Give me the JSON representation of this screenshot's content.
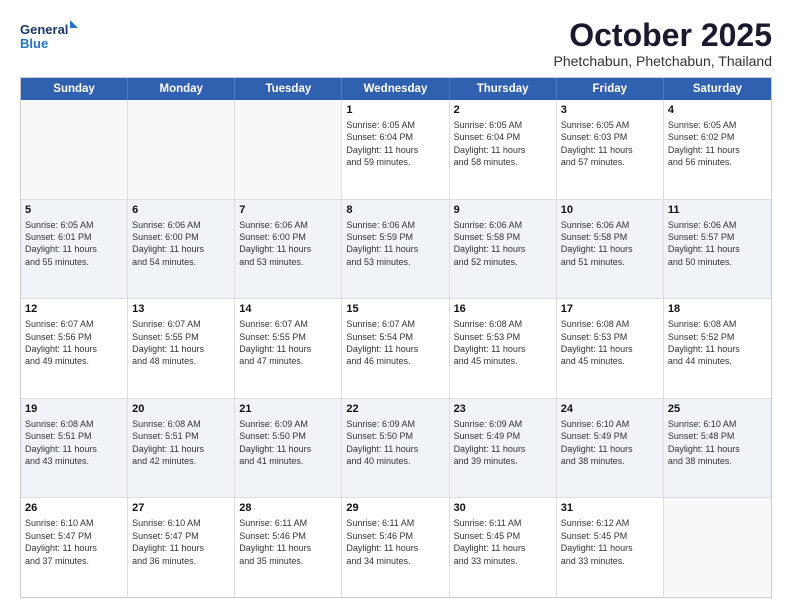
{
  "header": {
    "logo_line1": "General",
    "logo_line2": "Blue",
    "month": "October 2025",
    "location": "Phetchabun, Phetchabun, Thailand"
  },
  "weekdays": [
    "Sunday",
    "Monday",
    "Tuesday",
    "Wednesday",
    "Thursday",
    "Friday",
    "Saturday"
  ],
  "weeks": [
    [
      {
        "day": "",
        "info": ""
      },
      {
        "day": "",
        "info": ""
      },
      {
        "day": "",
        "info": ""
      },
      {
        "day": "1",
        "info": "Sunrise: 6:05 AM\nSunset: 6:04 PM\nDaylight: 11 hours\nand 59 minutes."
      },
      {
        "day": "2",
        "info": "Sunrise: 6:05 AM\nSunset: 6:04 PM\nDaylight: 11 hours\nand 58 minutes."
      },
      {
        "day": "3",
        "info": "Sunrise: 6:05 AM\nSunset: 6:03 PM\nDaylight: 11 hours\nand 57 minutes."
      },
      {
        "day": "4",
        "info": "Sunrise: 6:05 AM\nSunset: 6:02 PM\nDaylight: 11 hours\nand 56 minutes."
      }
    ],
    [
      {
        "day": "5",
        "info": "Sunrise: 6:05 AM\nSunset: 6:01 PM\nDaylight: 11 hours\nand 55 minutes."
      },
      {
        "day": "6",
        "info": "Sunrise: 6:06 AM\nSunset: 6:00 PM\nDaylight: 11 hours\nand 54 minutes."
      },
      {
        "day": "7",
        "info": "Sunrise: 6:06 AM\nSunset: 6:00 PM\nDaylight: 11 hours\nand 53 minutes."
      },
      {
        "day": "8",
        "info": "Sunrise: 6:06 AM\nSunset: 5:59 PM\nDaylight: 11 hours\nand 53 minutes."
      },
      {
        "day": "9",
        "info": "Sunrise: 6:06 AM\nSunset: 5:58 PM\nDaylight: 11 hours\nand 52 minutes."
      },
      {
        "day": "10",
        "info": "Sunrise: 6:06 AM\nSunset: 5:58 PM\nDaylight: 11 hours\nand 51 minutes."
      },
      {
        "day": "11",
        "info": "Sunrise: 6:06 AM\nSunset: 5:57 PM\nDaylight: 11 hours\nand 50 minutes."
      }
    ],
    [
      {
        "day": "12",
        "info": "Sunrise: 6:07 AM\nSunset: 5:56 PM\nDaylight: 11 hours\nand 49 minutes."
      },
      {
        "day": "13",
        "info": "Sunrise: 6:07 AM\nSunset: 5:55 PM\nDaylight: 11 hours\nand 48 minutes."
      },
      {
        "day": "14",
        "info": "Sunrise: 6:07 AM\nSunset: 5:55 PM\nDaylight: 11 hours\nand 47 minutes."
      },
      {
        "day": "15",
        "info": "Sunrise: 6:07 AM\nSunset: 5:54 PM\nDaylight: 11 hours\nand 46 minutes."
      },
      {
        "day": "16",
        "info": "Sunrise: 6:08 AM\nSunset: 5:53 PM\nDaylight: 11 hours\nand 45 minutes."
      },
      {
        "day": "17",
        "info": "Sunrise: 6:08 AM\nSunset: 5:53 PM\nDaylight: 11 hours\nand 45 minutes."
      },
      {
        "day": "18",
        "info": "Sunrise: 6:08 AM\nSunset: 5:52 PM\nDaylight: 11 hours\nand 44 minutes."
      }
    ],
    [
      {
        "day": "19",
        "info": "Sunrise: 6:08 AM\nSunset: 5:51 PM\nDaylight: 11 hours\nand 43 minutes."
      },
      {
        "day": "20",
        "info": "Sunrise: 6:08 AM\nSunset: 5:51 PM\nDaylight: 11 hours\nand 42 minutes."
      },
      {
        "day": "21",
        "info": "Sunrise: 6:09 AM\nSunset: 5:50 PM\nDaylight: 11 hours\nand 41 minutes."
      },
      {
        "day": "22",
        "info": "Sunrise: 6:09 AM\nSunset: 5:50 PM\nDaylight: 11 hours\nand 40 minutes."
      },
      {
        "day": "23",
        "info": "Sunrise: 6:09 AM\nSunset: 5:49 PM\nDaylight: 11 hours\nand 39 minutes."
      },
      {
        "day": "24",
        "info": "Sunrise: 6:10 AM\nSunset: 5:49 PM\nDaylight: 11 hours\nand 38 minutes."
      },
      {
        "day": "25",
        "info": "Sunrise: 6:10 AM\nSunset: 5:48 PM\nDaylight: 11 hours\nand 38 minutes."
      }
    ],
    [
      {
        "day": "26",
        "info": "Sunrise: 6:10 AM\nSunset: 5:47 PM\nDaylight: 11 hours\nand 37 minutes."
      },
      {
        "day": "27",
        "info": "Sunrise: 6:10 AM\nSunset: 5:47 PM\nDaylight: 11 hours\nand 36 minutes."
      },
      {
        "day": "28",
        "info": "Sunrise: 6:11 AM\nSunset: 5:46 PM\nDaylight: 11 hours\nand 35 minutes."
      },
      {
        "day": "29",
        "info": "Sunrise: 6:11 AM\nSunset: 5:46 PM\nDaylight: 11 hours\nand 34 minutes."
      },
      {
        "day": "30",
        "info": "Sunrise: 6:11 AM\nSunset: 5:45 PM\nDaylight: 11 hours\nand 33 minutes."
      },
      {
        "day": "31",
        "info": "Sunrise: 6:12 AM\nSunset: 5:45 PM\nDaylight: 11 hours\nand 33 minutes."
      },
      {
        "day": "",
        "info": ""
      }
    ]
  ]
}
